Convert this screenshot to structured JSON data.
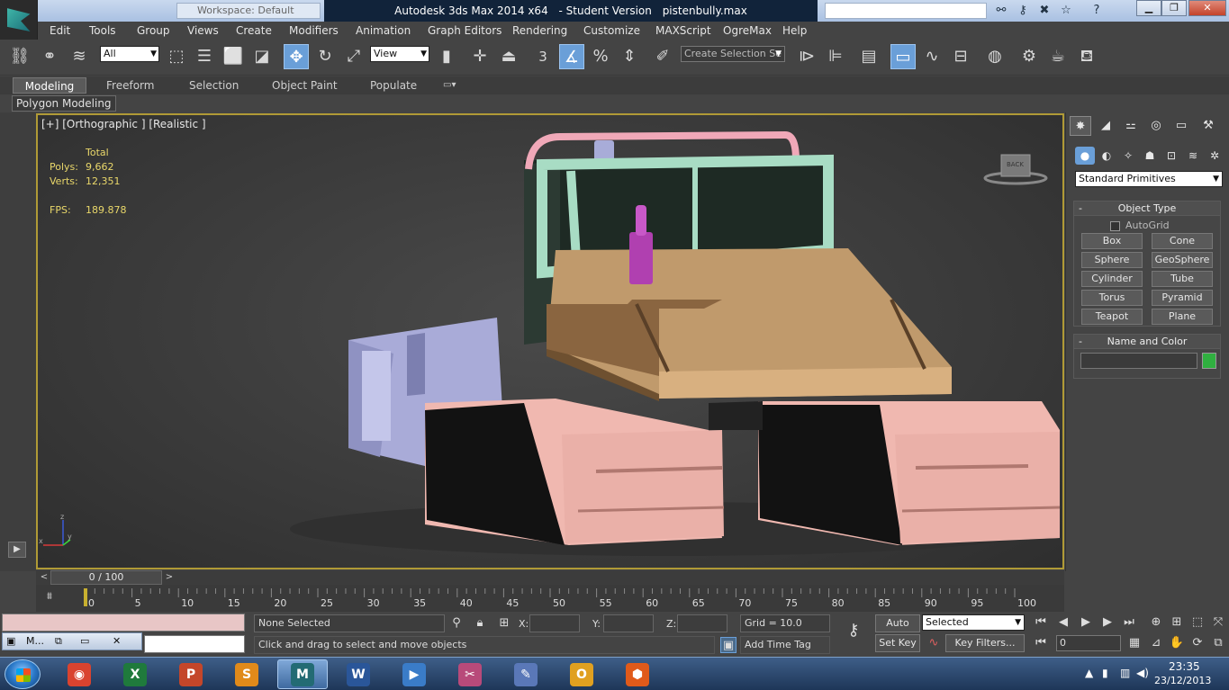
{
  "title": {
    "workspace": "Workspace: Default",
    "app": "Autodesk 3ds Max  2014 x64",
    "edition": "- Student Version",
    "file": "pistenbully.max"
  },
  "menu": [
    "Edit",
    "Tools",
    "Group",
    "Views",
    "Create",
    "Modifiers",
    "Animation",
    "Graph Editors",
    "Rendering",
    "Customize",
    "MAXScript",
    "OgreMax",
    "Help"
  ],
  "toolbar": {
    "filter_value": "All",
    "coord_value": "View",
    "snap_label": "3",
    "selection_set_placeholder": "Create Selection Se"
  },
  "ribbon": {
    "tabs": [
      "Modeling",
      "Freeform",
      "Selection",
      "Object Paint",
      "Populate"
    ],
    "panel": "Polygon Modeling"
  },
  "viewport": {
    "label": "[+] [Orthographic ] [Realistic ]",
    "stats_header": "Total",
    "polys_label": "Polys:",
    "polys_value": "9,662",
    "verts_label": "Verts:",
    "verts_value": "12,351",
    "fps_label": "FPS:",
    "fps_value": "189.878",
    "viewcube_label": "BACK"
  },
  "command_panel": {
    "dropdown": "Standard Primitives",
    "object_type_title": "Object Type",
    "autogrid": "AutoGrid",
    "primitives": [
      "Box",
      "Cone",
      "Sphere",
      "GeoSphere",
      "Cylinder",
      "Tube",
      "Torus",
      "Pyramid",
      "Teapot",
      "Plane"
    ],
    "name_color_title": "Name and Color",
    "swatch_color": "#30b040"
  },
  "timeline": {
    "frame_display": "0 / 100",
    "ticks": [
      "0",
      "5",
      "10",
      "15",
      "20",
      "25",
      "30",
      "35",
      "40",
      "45",
      "50",
      "55",
      "60",
      "65",
      "70",
      "75",
      "80",
      "85",
      "90",
      "95",
      "100"
    ]
  },
  "status": {
    "selection": "None Selected",
    "prompt": "Click and drag to select and move objects",
    "x_label": "X:",
    "y_label": "Y:",
    "z_label": "Z:",
    "grid": "Grid = 10.0",
    "add_time_tag": "Add Time Tag",
    "auto_key": "Auto Key",
    "set_key": "Set Key",
    "key_filters": "Key Filters...",
    "selected_dropdown": "Selected",
    "frame": "0",
    "task_thumb": "M..."
  },
  "taskbar": {
    "apps": [
      {
        "name": "chrome",
        "color": "#d9432f",
        "glyph": "◉"
      },
      {
        "name": "excel",
        "color": "#1f7a3c",
        "glyph": "X"
      },
      {
        "name": "powerpoint",
        "color": "#c4462a",
        "glyph": "P"
      },
      {
        "name": "sketch",
        "color": "#e08a1a",
        "glyph": "S"
      },
      {
        "name": "3dsmax",
        "color": "#236b74",
        "glyph": "M"
      },
      {
        "name": "word",
        "color": "#2a5699",
        "glyph": "W"
      },
      {
        "name": "media",
        "color": "#3a7cc8",
        "glyph": "▶"
      },
      {
        "name": "snipping",
        "color": "#b84a7a",
        "glyph": "✂"
      },
      {
        "name": "paint",
        "color": "#5a78b8",
        "glyph": "✎"
      },
      {
        "name": "outlook",
        "color": "#e0a020",
        "glyph": "O"
      },
      {
        "name": "network",
        "color": "#e05a1a",
        "glyph": "⬢"
      }
    ],
    "time": "23:35",
    "date": "23/12/2013"
  }
}
